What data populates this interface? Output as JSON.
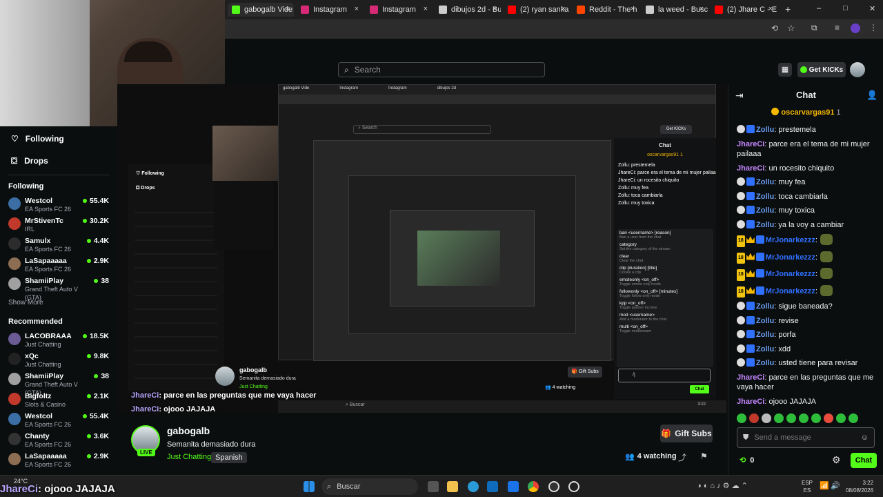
{
  "browser": {
    "tabs": [
      {
        "label": "gabogalb Vide",
        "color": "#53fc18"
      },
      {
        "label": "Instagram",
        "color": "#d62976"
      },
      {
        "label": "Instagram",
        "color": "#d62976"
      },
      {
        "label": "dibujos 2d - Bu",
        "color": "#cccccc"
      },
      {
        "label": "(2) ryan sanka",
        "color": "#ff0000"
      },
      {
        "label": "Reddit - The h",
        "color": "#ff4500"
      },
      {
        "label": "la weed - Busc",
        "color": "#cccccc"
      },
      {
        "label": "(2) Jhare C - E",
        "color": "#ff0000"
      }
    ],
    "new_tab": "+",
    "window_controls": [
      "–",
      "□",
      "✕"
    ]
  },
  "header": {
    "search_placeholder": "Search",
    "get_kicks": "Get KICKs"
  },
  "sidebar": {
    "nav": [
      {
        "label": "Following",
        "icon": "heart-icon"
      },
      {
        "label": "Drops",
        "icon": "drops-icon"
      }
    ],
    "following_title": "Following",
    "following": [
      {
        "name": "Westcol",
        "category": "EA Sports FC 26",
        "viewers": "55.4K",
        "color": "#3a6ea5"
      },
      {
        "name": "MrStivenTc",
        "category": "IRL",
        "viewers": "30.2K",
        "color": "#c0392b"
      },
      {
        "name": "Samulx",
        "category": "EA Sports FC 26",
        "viewers": "4.4K",
        "color": "#2c2c2c"
      },
      {
        "name": "LaSapaaaaa",
        "category": "EA Sports FC 26",
        "viewers": "2.9K",
        "color": "#8e6e53"
      },
      {
        "name": "ShamiiPlay",
        "category": "Grand Theft Auto V (GTA)",
        "viewers": "38",
        "color": "#a0a0a0"
      }
    ],
    "show_more": "Show More",
    "recommended_title": "Recommended",
    "recommended": [
      {
        "name": "LACOBRAAA",
        "category": "Just Chatting",
        "viewers": "18.5K",
        "color": "#6b5b95"
      },
      {
        "name": "xQc",
        "category": "Just Chatting",
        "viewers": "9.8K",
        "color": "#222222"
      },
      {
        "name": "ShamiiPlay",
        "category": "Grand Theft Auto V (GTA)",
        "viewers": "38",
        "color": "#a0a0a0"
      },
      {
        "name": "Bigfoltz",
        "category": "Slots & Casino",
        "viewers": "2.1K",
        "color": "#c0392b"
      },
      {
        "name": "Westcol",
        "category": "EA Sports FC 26",
        "viewers": "55.4K",
        "color": "#3a6ea5"
      },
      {
        "name": "Chanty",
        "category": "EA Sports FC 26",
        "viewers": "3.6K",
        "color": "#333333"
      },
      {
        "name": "LaSapaaaaa",
        "category": "EA Sports FC 26",
        "viewers": "2.9K",
        "color": "#8e6e53"
      }
    ]
  },
  "stream": {
    "overlay_line1_user": "JhareCi",
    "overlay_line1_text": ": parce en las preguntas que me vaya hacer",
    "overlay_line2_user": "JhareCi",
    "overlay_line2_text": ": ojooo JAJAJA",
    "overlay_bottom_user": "JhareCi",
    "overlay_bottom_text": ": ojooo JAJAJA",
    "weather": "24°C",
    "inner_chat": [
      "Zollu: prestemela",
      "JhareCi: parce era el tema de mi mujer pailaaa",
      "JhareCi: un rocesito chiquito",
      "Zollu: muy fea",
      "Zollu: toca cambiarla",
      "Zollu: muy toxica"
    ],
    "inner_commands": [
      {
        "cmd": "ban <username> [reason]",
        "desc": "Ban a user from the chat"
      },
      {
        "cmd": "category",
        "desc": "Set the category of the stream"
      },
      {
        "cmd": "clear",
        "desc": "Clear the chat"
      },
      {
        "cmd": "clip [duration] [title]",
        "desc": "Create a clip"
      },
      {
        "cmd": "emoteonly <on_off>",
        "desc": "Toggle emote only mode"
      },
      {
        "cmd": "followonly <on_off> [minutes]",
        "desc": "Toggle follow only mode"
      },
      {
        "cmd": "kpp <on_off>",
        "desc": "Toggle partner income"
      },
      {
        "cmd": "mod <username>",
        "desc": "Add a moderator to the chat"
      },
      {
        "cmd": "multi <on_off>",
        "desc": "Toggle multistream"
      }
    ],
    "inner_input": "/|"
  },
  "info": {
    "channel": "gabogalb",
    "title": "Semanita demasiado dura",
    "category": "Just Chatting",
    "tag": "Spanish",
    "live": "LIVE",
    "gift_subs": "Gift Subs",
    "watching": "4 watching"
  },
  "chat": {
    "title": "Chat",
    "pinned_user": "oscarvargas91",
    "pinned_count": "1",
    "messages": [
      {
        "user": "Zollu",
        "text": ": prestemela",
        "type": "z"
      },
      {
        "user": "JhareCi",
        "text": ": parce era el tema de mi mujer pailaaa",
        "type": "j"
      },
      {
        "user": "JhareCi",
        "text": ": un rocesito chiquito",
        "type": "j"
      },
      {
        "user": "Zollu",
        "text": ": muy fea",
        "type": "z"
      },
      {
        "user": "Zollu",
        "text": ": toca cambiarla",
        "type": "z"
      },
      {
        "user": "Zollu",
        "text": ": muy toxica",
        "type": "z"
      },
      {
        "user": "Zollu",
        "text": ": ya la voy a cambiar",
        "type": "z"
      },
      {
        "user": "MrJonarkezzz",
        "text": ":",
        "type": "m"
      },
      {
        "user": "MrJonarkezzz",
        "text": ":",
        "type": "m"
      },
      {
        "user": "MrJonarkezzz",
        "text": ":",
        "type": "m"
      },
      {
        "user": "MrJonarkezzz",
        "text": ":",
        "type": "m"
      },
      {
        "user": "Zollu",
        "text": ": sigue baneada?",
        "type": "z"
      },
      {
        "user": "Zollu",
        "text": ": revise",
        "type": "z"
      },
      {
        "user": "Zollu",
        "text": ": porfa",
        "type": "z"
      },
      {
        "user": "Zollu",
        "text": ": xdd",
        "type": "z"
      },
      {
        "user": "Zollu",
        "text": ": usted tiene para revisar",
        "type": "z"
      },
      {
        "user": "JhareCi",
        "text": ": parce en las preguntas que me vaya hacer",
        "type": "j"
      },
      {
        "user": "JhareCi",
        "text": ": ojooo JAJAJA",
        "type": "j"
      }
    ],
    "badge18": "18",
    "input_placeholder": "Send a message",
    "points": "0",
    "send": "Chat"
  },
  "taskbar": {
    "search": "Buscar",
    "lang1": "ESP",
    "lang2": "ES",
    "time": "3:22",
    "date": "08/08/2026"
  }
}
